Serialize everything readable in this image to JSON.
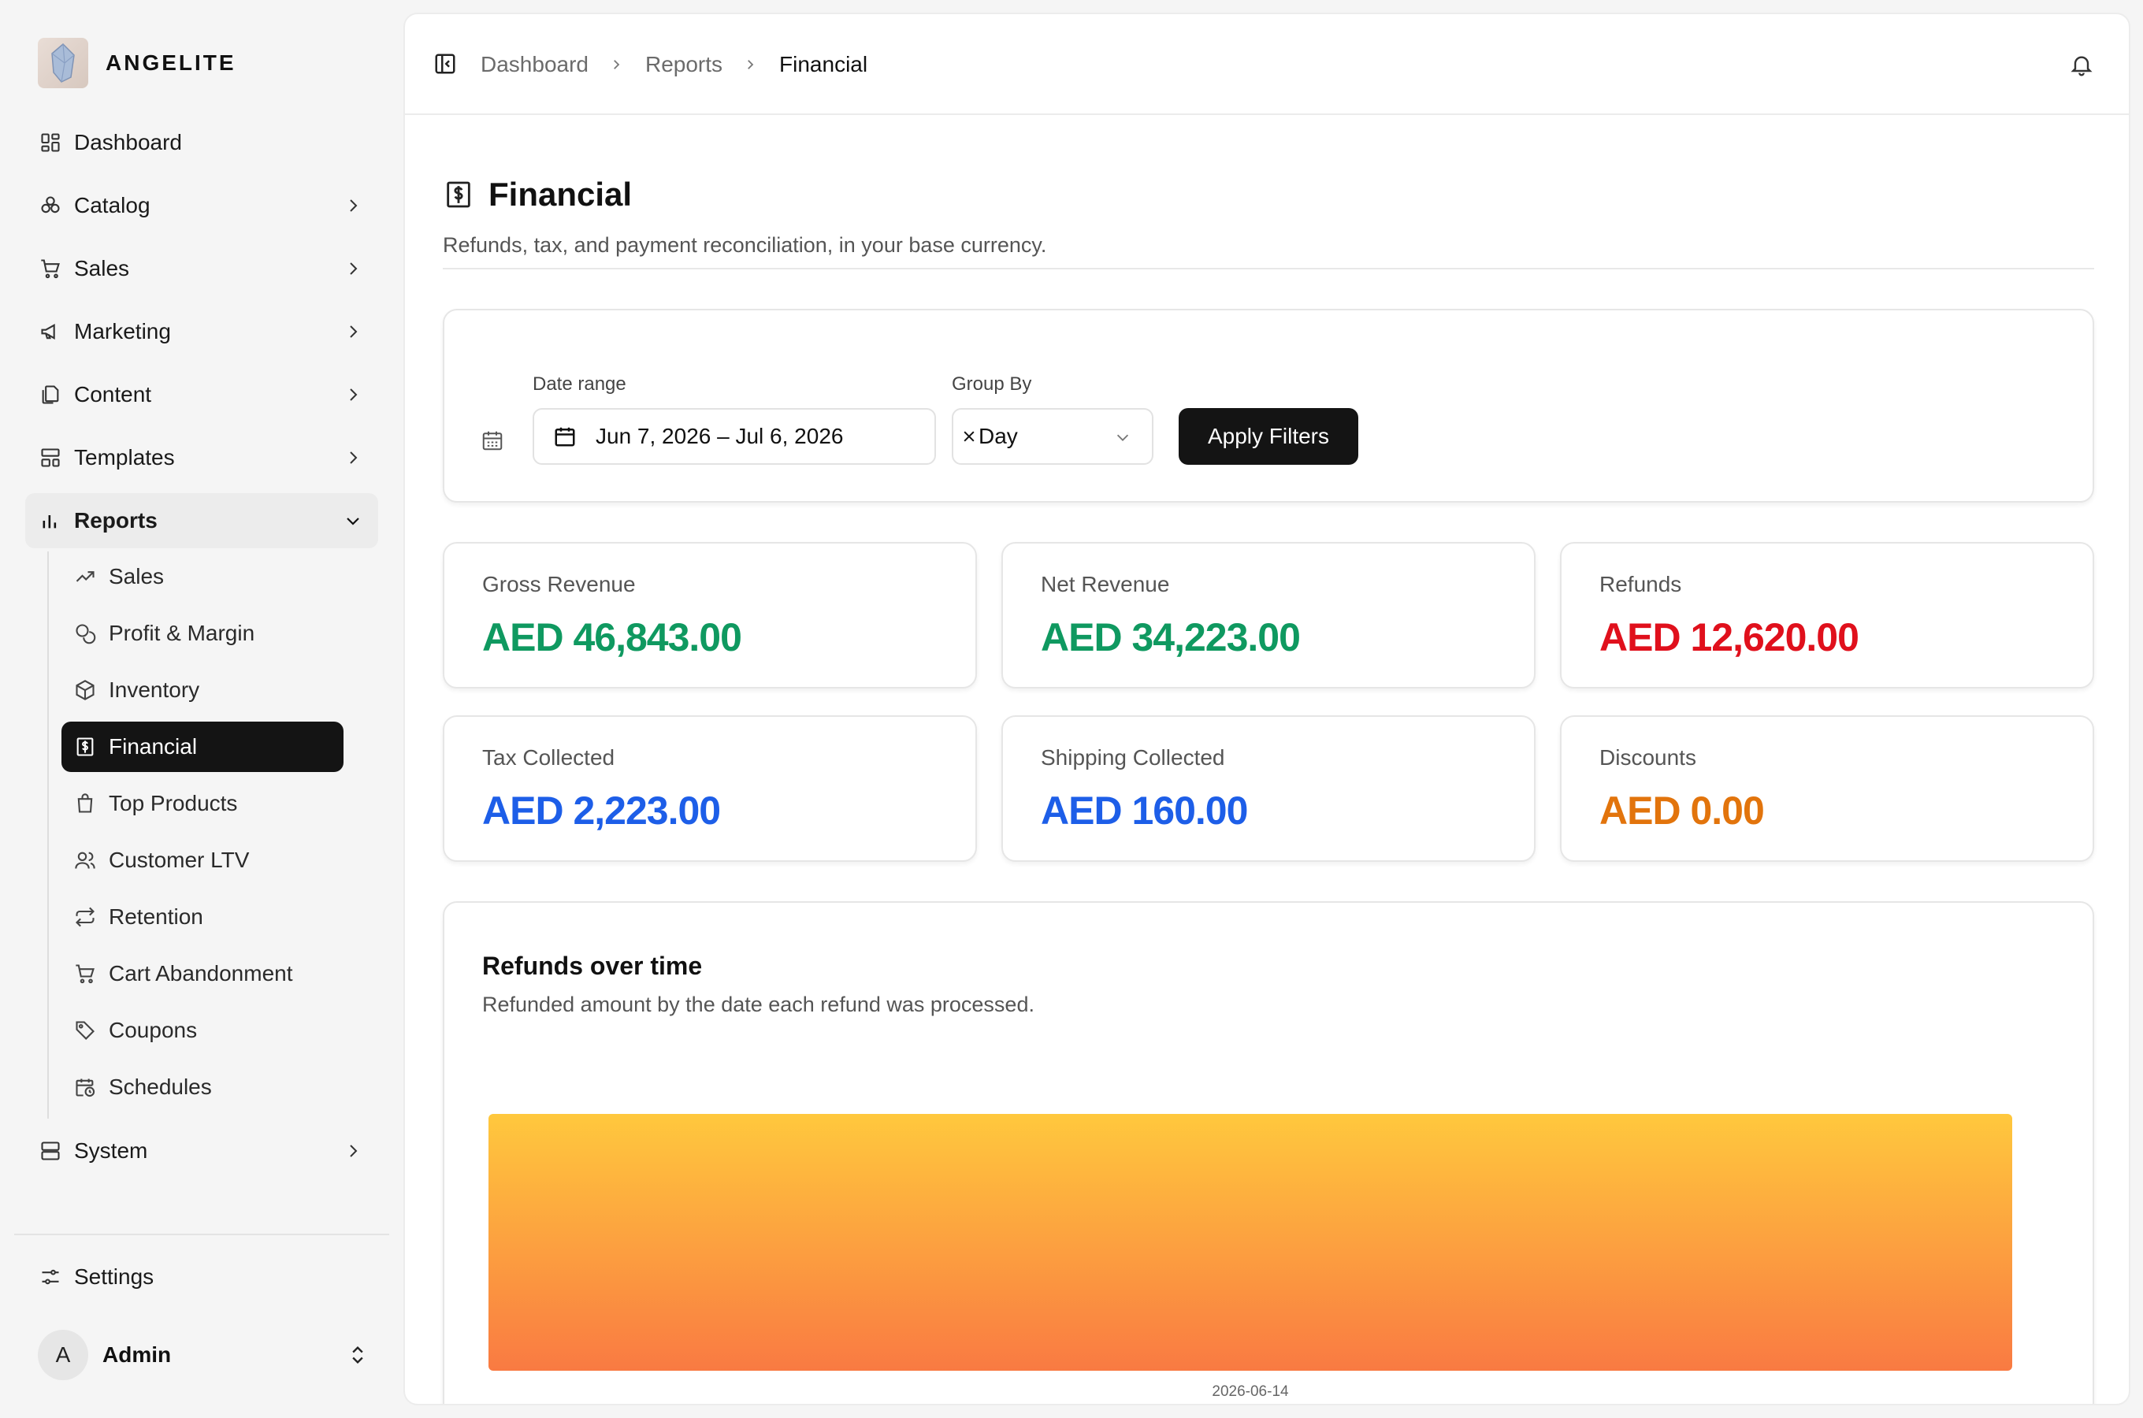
{
  "brand": {
    "name": "ANGELITE"
  },
  "sidebar": {
    "items": [
      {
        "label": "Dashboard",
        "icon": "dashboard-icon"
      },
      {
        "label": "Catalog",
        "icon": "catalog-icon"
      },
      {
        "label": "Sales",
        "icon": "cart-icon"
      },
      {
        "label": "Marketing",
        "icon": "megaphone-icon"
      },
      {
        "label": "Content",
        "icon": "files-icon"
      },
      {
        "label": "Templates",
        "icon": "templates-icon"
      },
      {
        "label": "Reports",
        "icon": "bar-chart-icon"
      },
      {
        "label": "System",
        "icon": "server-icon"
      }
    ],
    "reports_sub": [
      {
        "label": "Sales",
        "icon": "trending-up-icon"
      },
      {
        "label": "Profit & Margin",
        "icon": "coins-icon"
      },
      {
        "label": "Inventory",
        "icon": "package-icon"
      },
      {
        "label": "Financial",
        "icon": "receipt-dollar-icon"
      },
      {
        "label": "Top Products",
        "icon": "shopping-bag-icon"
      },
      {
        "label": "Customer LTV",
        "icon": "users-icon"
      },
      {
        "label": "Retention",
        "icon": "repeat-icon"
      },
      {
        "label": "Cart Abandonment",
        "icon": "cart-icon"
      },
      {
        "label": "Coupons",
        "icon": "tag-icon"
      },
      {
        "label": "Schedules",
        "icon": "calendar-clock-icon"
      }
    ],
    "settings_label": "Settings",
    "user": {
      "initial": "A",
      "name": "Admin"
    }
  },
  "breadcrumb": [
    "Dashboard",
    "Reports",
    "Financial"
  ],
  "page": {
    "title": "Financial",
    "subtitle": "Refunds, tax, and payment reconciliation, in your base currency."
  },
  "filters": {
    "date_label": "Date range",
    "date_value": "Jun 7, 2026 – Jul 6, 2026",
    "group_label": "Group By",
    "group_value": "Day",
    "apply_label": "Apply Filters"
  },
  "stats": [
    {
      "label": "Gross Revenue",
      "value": "AED 46,843.00",
      "color": "#0f9960"
    },
    {
      "label": "Net Revenue",
      "value": "AED 34,223.00",
      "color": "#0f9960"
    },
    {
      "label": "Refunds",
      "value": "AED 12,620.00",
      "color": "#e0101c"
    },
    {
      "label": "Tax Collected",
      "value": "AED 2,223.00",
      "color": "#1d5ee8"
    },
    {
      "label": "Shipping Collected",
      "value": "AED 160.00",
      "color": "#1d5ee8"
    },
    {
      "label": "Discounts",
      "value": "AED 0.00",
      "color": "#e2740c"
    }
  ],
  "chart": {
    "title": "Refunds over time",
    "subtitle": "Refunded amount by the date each refund was processed."
  },
  "chart_data": {
    "type": "bar",
    "categories": [
      "2026-06-14"
    ],
    "values": [
      12620
    ],
    "colors": {
      "top": "#ffc83d",
      "bottom": "#f97a42"
    },
    "ylim": [
      0,
      12620
    ],
    "grid": false
  }
}
